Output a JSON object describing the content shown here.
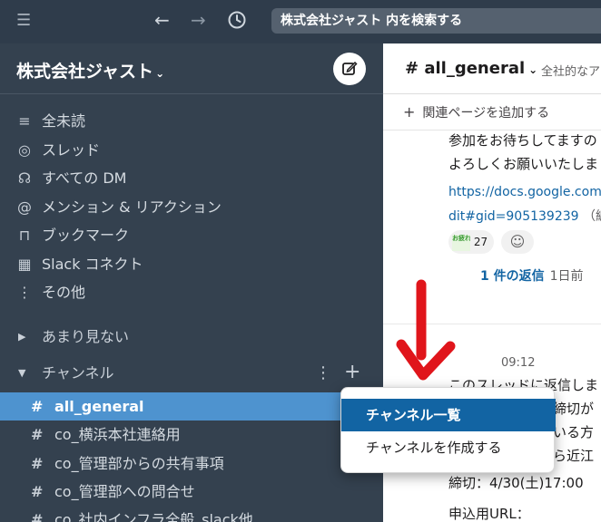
{
  "topbar": {
    "search_placeholder": "株式会社ジャスト 内を検索する"
  },
  "workspace": {
    "name": "株式会社ジャスト",
    "caret": "⌄"
  },
  "sidebar": {
    "nav_items": [
      {
        "icon": "list-icon",
        "glyph": "≡",
        "label": "全未読"
      },
      {
        "icon": "thread-icon",
        "glyph": "◎",
        "label": "スレッド"
      },
      {
        "icon": "dm-icon",
        "glyph": "☊",
        "label": "すべての DM"
      },
      {
        "icon": "mention-icon",
        "glyph": "@",
        "label": "メンション & リアクション"
      },
      {
        "icon": "bookmark-icon",
        "glyph": "⊓",
        "label": "ブックマーク"
      },
      {
        "icon": "building-icon",
        "glyph": "▦",
        "label": "Slack コネクト"
      },
      {
        "icon": "more-icon",
        "glyph": "⋮",
        "label": "その他"
      }
    ],
    "section_infrequent": "あまり見ない",
    "section_channels": "チャンネル",
    "channels": [
      {
        "label": "all_general",
        "active": true
      },
      {
        "label": "co_横浜本社連絡用",
        "active": false
      },
      {
        "label": "co_管理部からの共有事項",
        "active": false
      },
      {
        "label": "co_管理部への問合せ",
        "active": false
      },
      {
        "label": "co_社内インフラ全般_slack他",
        "active": false
      }
    ]
  },
  "main": {
    "channel_title": "# all_general",
    "topic": "全社的なア",
    "bookmark_add": "関連ページを追加する",
    "message1_line1": "参加をお待ちしてますの",
    "message1_line2": "よろしくお願いいたしま",
    "link_line1": "https://docs.google.com/",
    "link_line2": "dit#gid=905139239",
    "link_suffix": "（編",
    "reaction_emoji_text": "お疲れ様です",
    "reaction_count": "27",
    "replies_count": "1 件の返信",
    "replies_ago": "1日前",
    "time": "09:12",
    "message2_lines": [
      "このスレッドに返信しま",
      "、締切が",
      "ている方",
      "たら近江"
    ],
    "deadline": "締切：4/30(土)17:00",
    "apply_url": "申込用URL："
  },
  "popup": {
    "items": [
      "チャンネル一覧",
      "チャンネルを作成する"
    ]
  },
  "colors": {
    "topbar_bg": "#2f3c4b",
    "sidebar_bg": "#34414f",
    "active_channel": "#4e93cf",
    "menu_highlight": "#1264a3",
    "arrow": "#e0151b"
  }
}
